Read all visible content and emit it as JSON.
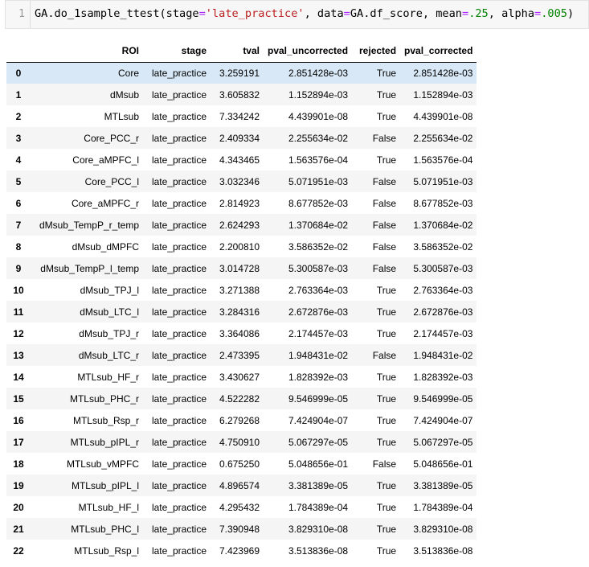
{
  "code_cell": {
    "line_number": "1",
    "tokens": [
      {
        "text": "GA.do_1sample_ttest(stage",
        "type": "plain"
      },
      {
        "text": "=",
        "type": "op"
      },
      {
        "text": "'late_practice'",
        "type": "str"
      },
      {
        "text": ", data",
        "type": "plain"
      },
      {
        "text": "=",
        "type": "op"
      },
      {
        "text": "GA.df_score, mean",
        "type": "plain"
      },
      {
        "text": "=",
        "type": "op"
      },
      {
        "text": ".25",
        "type": "num"
      },
      {
        "text": ", alpha",
        "type": "plain"
      },
      {
        "text": "=",
        "type": "op"
      },
      {
        "text": ".005",
        "type": "num"
      },
      {
        "text": ")",
        "type": "plain"
      }
    ],
    "colors": {
      "string": "#BA2121",
      "operator": "#AA22FF",
      "number": "#008000"
    }
  },
  "table": {
    "selected_row": 0,
    "colors": {
      "selected": "#d8e8f6",
      "stripe": "#f5f5f5"
    },
    "columns": [
      "",
      "ROI",
      "stage",
      "tval",
      "pval_uncorrected",
      "rejected",
      "pval_corrected"
    ],
    "rows": [
      [
        "0",
        "Core",
        "late_practice",
        "3.259191",
        "2.851428e-03",
        "True",
        "2.851428e-03"
      ],
      [
        "1",
        "dMsub",
        "late_practice",
        "3.605832",
        "1.152894e-03",
        "True",
        "1.152894e-03"
      ],
      [
        "2",
        "MTLsub",
        "late_practice",
        "7.334242",
        "4.439901e-08",
        "True",
        "4.439901e-08"
      ],
      [
        "3",
        "Core_PCC_r",
        "late_practice",
        "2.409334",
        "2.255634e-02",
        "False",
        "2.255634e-02"
      ],
      [
        "4",
        "Core_aMPFC_l",
        "late_practice",
        "4.343465",
        "1.563576e-04",
        "True",
        "1.563576e-04"
      ],
      [
        "5",
        "Core_PCC_l",
        "late_practice",
        "3.032346",
        "5.071951e-03",
        "False",
        "5.071951e-03"
      ],
      [
        "6",
        "Core_aMPFC_r",
        "late_practice",
        "2.814923",
        "8.677852e-03",
        "False",
        "8.677852e-03"
      ],
      [
        "7",
        "dMsub_TempP_r_temp",
        "late_practice",
        "2.624293",
        "1.370684e-02",
        "False",
        "1.370684e-02"
      ],
      [
        "8",
        "dMsub_dMPFC",
        "late_practice",
        "2.200810",
        "3.586352e-02",
        "False",
        "3.586352e-02"
      ],
      [
        "9",
        "dMsub_TempP_l_temp",
        "late_practice",
        "3.014728",
        "5.300587e-03",
        "False",
        "5.300587e-03"
      ],
      [
        "10",
        "dMsub_TPJ_l",
        "late_practice",
        "3.271388",
        "2.763364e-03",
        "True",
        "2.763364e-03"
      ],
      [
        "11",
        "dMsub_LTC_l",
        "late_practice",
        "3.284316",
        "2.672876e-03",
        "True",
        "2.672876e-03"
      ],
      [
        "12",
        "dMsub_TPJ_r",
        "late_practice",
        "3.364086",
        "2.174457e-03",
        "True",
        "2.174457e-03"
      ],
      [
        "13",
        "dMsub_LTC_r",
        "late_practice",
        "2.473395",
        "1.948431e-02",
        "False",
        "1.948431e-02"
      ],
      [
        "14",
        "MTLsub_HF_r",
        "late_practice",
        "3.430627",
        "1.828392e-03",
        "True",
        "1.828392e-03"
      ],
      [
        "15",
        "MTLsub_PHC_r",
        "late_practice",
        "4.522282",
        "9.546999e-05",
        "True",
        "9.546999e-05"
      ],
      [
        "16",
        "MTLsub_Rsp_r",
        "late_practice",
        "6.279268",
        "7.424904e-07",
        "True",
        "7.424904e-07"
      ],
      [
        "17",
        "MTLsub_pIPL_r",
        "late_practice",
        "4.750910",
        "5.067297e-05",
        "True",
        "5.067297e-05"
      ],
      [
        "18",
        "MTLsub_vMPFC",
        "late_practice",
        "0.675250",
        "5.048656e-01",
        "False",
        "5.048656e-01"
      ],
      [
        "19",
        "MTLsub_pIPL_l",
        "late_practice",
        "4.896574",
        "3.381389e-05",
        "True",
        "3.381389e-05"
      ],
      [
        "20",
        "MTLsub_HF_l",
        "late_practice",
        "4.295432",
        "1.784389e-04",
        "True",
        "1.784389e-04"
      ],
      [
        "21",
        "MTLsub_PHC_l",
        "late_practice",
        "7.390948",
        "3.829310e-08",
        "True",
        "3.829310e-08"
      ],
      [
        "22",
        "MTLsub_Rsp_l",
        "late_practice",
        "7.423969",
        "3.513836e-08",
        "True",
        "3.513836e-08"
      ]
    ]
  }
}
